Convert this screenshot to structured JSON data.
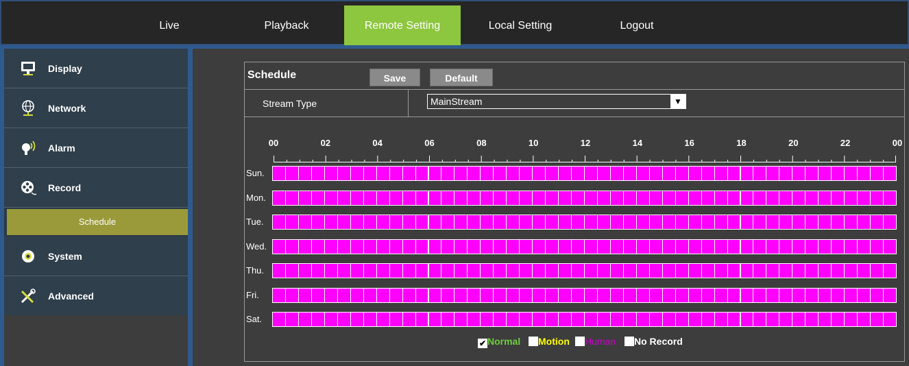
{
  "nav": {
    "tabs": [
      {
        "label": "Live"
      },
      {
        "label": "Playback"
      },
      {
        "label": "Remote Setting"
      },
      {
        "label": "Local Setting"
      },
      {
        "label": "Logout"
      }
    ],
    "active_tab": "Remote Setting",
    "active_color": "#8dc63f"
  },
  "sidebar": {
    "items": [
      {
        "label": "Display",
        "icon": "monitor-icon"
      },
      {
        "label": "Network",
        "icon": "globe-network-icon"
      },
      {
        "label": "Alarm",
        "icon": "alarm-bulb-icon"
      },
      {
        "label": "Record",
        "icon": "film-reel-icon"
      },
      {
        "label": "System",
        "icon": "gear-icon"
      },
      {
        "label": "Advanced",
        "icon": "tools-icon"
      }
    ],
    "subitem": {
      "label": "Schedule"
    }
  },
  "panel": {
    "title": "Schedule",
    "save_label": "Save",
    "default_label": "Default",
    "stream_type_label": "Stream Type",
    "stream_type_value": "MainStream"
  },
  "grid": {
    "hours": [
      "00",
      "02",
      "04",
      "06",
      "08",
      "10",
      "12",
      "14",
      "16",
      "18",
      "20",
      "22",
      "00"
    ],
    "days": [
      "Sun.",
      "Mon.",
      "Tue.",
      "Wed.",
      "Thu.",
      "Fri.",
      "Sat."
    ],
    "cell_color": "#ff00ff",
    "mode": "Human"
  },
  "legend": {
    "normal": {
      "label": "Normal",
      "color": "#6ccf3a",
      "checked": true
    },
    "motion": {
      "label": "Motion",
      "color": "#ffff00",
      "checked": false
    },
    "human": {
      "label": "Human",
      "color": "#cc00cc",
      "checked": false
    },
    "norecord": {
      "label": "No Record",
      "color": "#ffffff",
      "checked": false
    }
  }
}
